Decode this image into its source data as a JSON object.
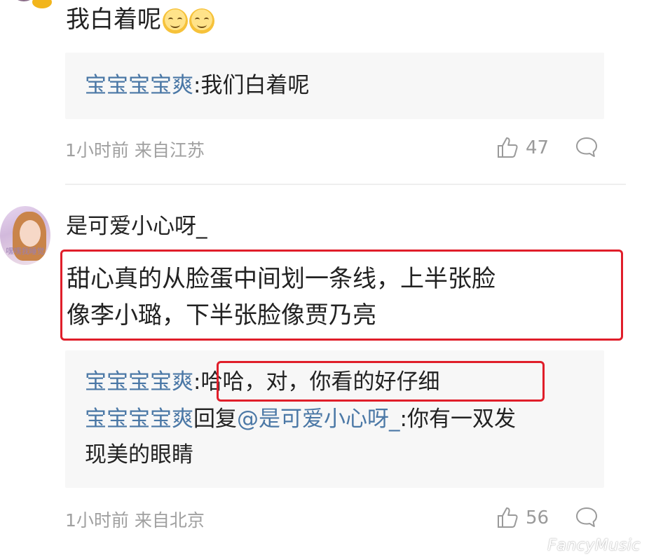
{
  "comment_top": {
    "text": "我白着呢",
    "emojis": [
      "blush-emoji",
      "blush-emoji"
    ],
    "reply": {
      "user": "宝宝宝宝爽",
      "separator": ":",
      "text": "我们白着呢"
    },
    "time": "1小时前",
    "location": "来自江苏",
    "likes": "47"
  },
  "comment_main": {
    "username": "是可爱小心呀_",
    "avatar_caption": "嘿嘿我睡觉",
    "text_line1": "甜心真的从脸蛋中间划一条线，上半张脸",
    "text_line2": "像李小璐，下半张脸像贾乃亮",
    "replies": {
      "r1_user": "宝宝宝宝爽",
      "r1_sep": ":",
      "r1_text": "哈哈，对，你看的好仔细",
      "r2_user": "宝宝宝宝爽",
      "r2_mid": "回复",
      "r2_mention": "@是可爱小心呀_",
      "r2_text_a": ":你有一双发",
      "r2_text_b": "现美的眼睛"
    },
    "time": "1小时前",
    "location": "来自北京",
    "likes": "56"
  },
  "watermark": "FancyMusic",
  "colors": {
    "username_link": "#4b78a6",
    "highlight": "#e01e2a",
    "reply_bg": "#f7f7f7"
  }
}
